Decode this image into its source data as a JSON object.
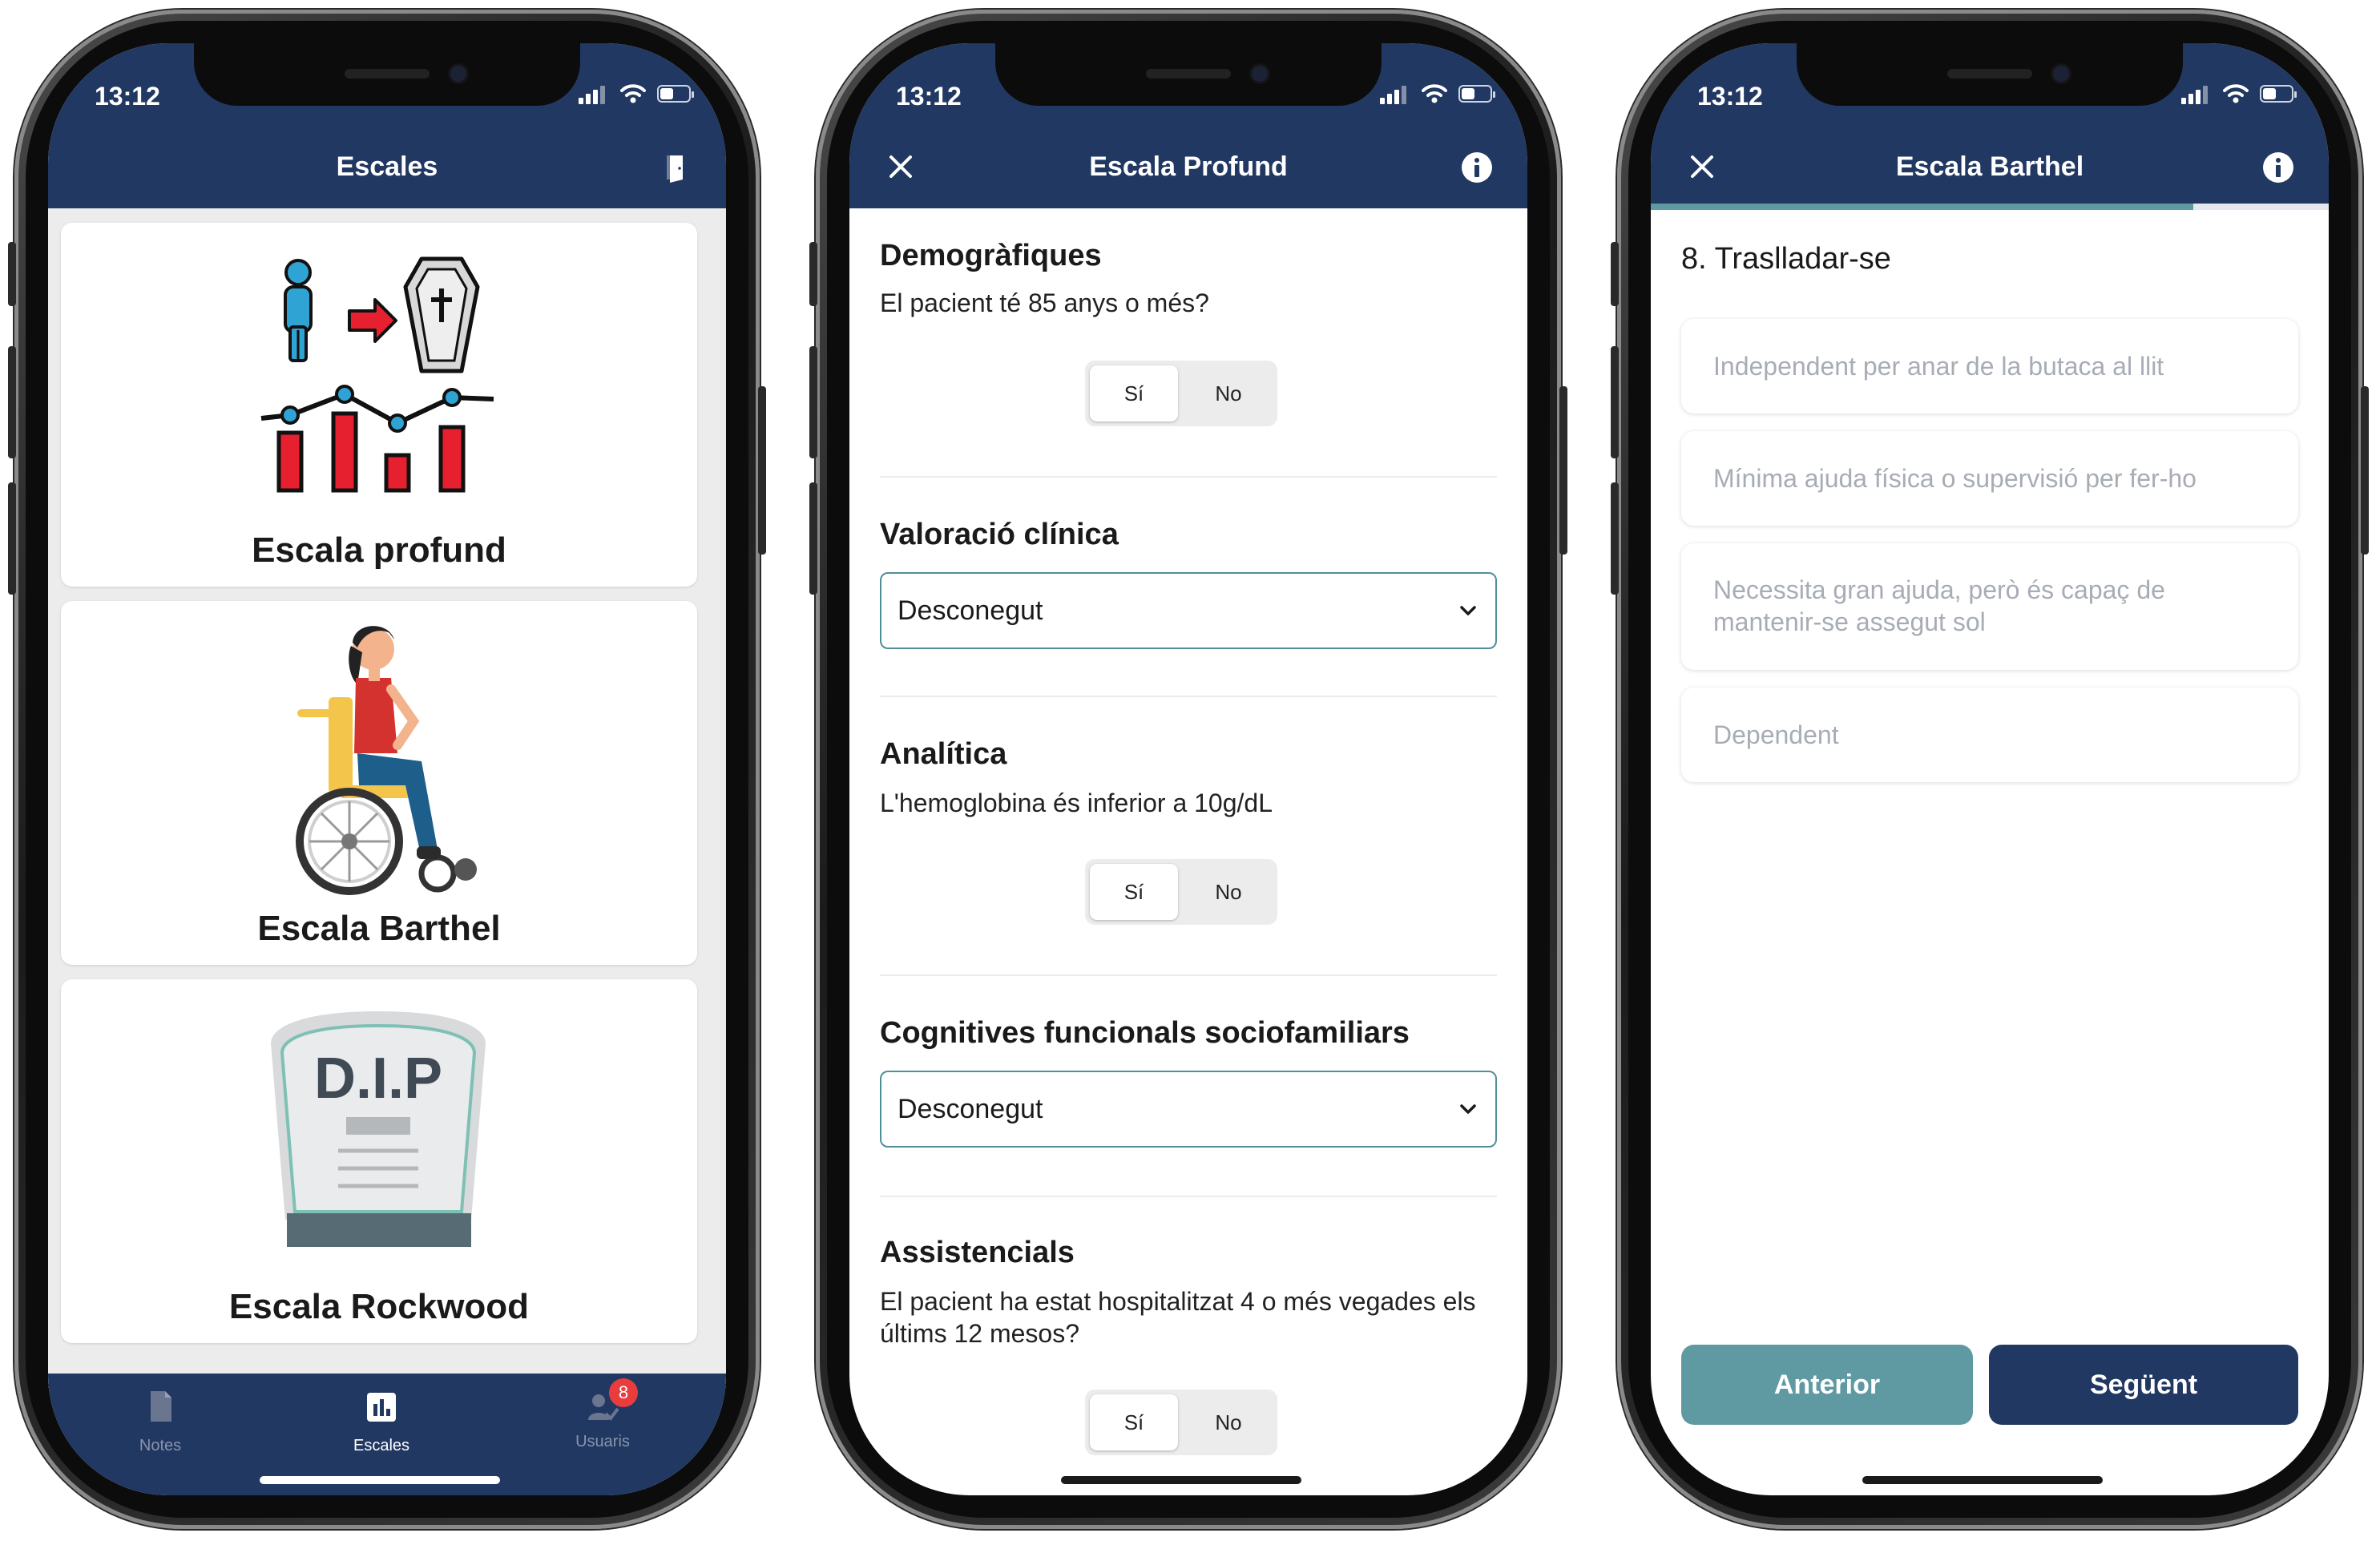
{
  "status_bar": {
    "time": "13:12"
  },
  "phone1": {
    "title": "Escales",
    "header_icon": "exit-door-icon",
    "cards": [
      {
        "label": "Escala profund",
        "icon": "deterioration-chart-illustration"
      },
      {
        "label": "Escala Barthel",
        "icon": "wheelchair-woman-illustration"
      },
      {
        "label": "Escala Rockwood",
        "icon": "tombstone-illustration",
        "illustration_text": "D.I.P"
      }
    ],
    "tabs": [
      {
        "label": "Notes",
        "icon": "document-icon",
        "active": false
      },
      {
        "label": "Escales",
        "icon": "bar-chart-icon",
        "active": true
      },
      {
        "label": "Usuaris",
        "icon": "users-check-icon",
        "active": false,
        "badge": "8"
      }
    ],
    "colors": {
      "header": "#213862",
      "badge": "#e93d3d"
    }
  },
  "phone2": {
    "title": "Escala Profund",
    "left_icon": "close-icon",
    "right_icon": "info-icon",
    "sections": [
      {
        "title": "Demogràfiques",
        "question": "El pacient té 85 anys o més?",
        "yes": "Sí",
        "no": "No"
      },
      {
        "title": "Valoració clínica",
        "select_value": "Desconegut"
      },
      {
        "title": "Analítica",
        "question": "L'hemoglobina és inferior a 10g/dL",
        "yes": "Sí",
        "no": "No"
      },
      {
        "title": "Cognitives funcionals sociofamiliars",
        "select_value": "Desconegut"
      },
      {
        "title": "Assistencials",
        "question": "El pacient ha estat hospitalitzat 4 o més vegades els últims 12 mesos?",
        "yes": "Sí",
        "no": "No"
      }
    ]
  },
  "phone3": {
    "title": "Escala Barthel",
    "left_icon": "close-icon",
    "right_icon": "info-icon",
    "progress": 0.8,
    "question": "8. Traslladar-se",
    "options": [
      "Independent per anar de la butaca al llit",
      "Mínima ajuda física o supervisió per fer-ho",
      "Necessita gran ajuda, però és capaç de mantenir-se assegut sol",
      "Dependent"
    ],
    "buttons": {
      "previous": "Anterior",
      "next": "Següent"
    },
    "colors": {
      "previous": "#5f9aa2",
      "next": "#213862"
    }
  }
}
